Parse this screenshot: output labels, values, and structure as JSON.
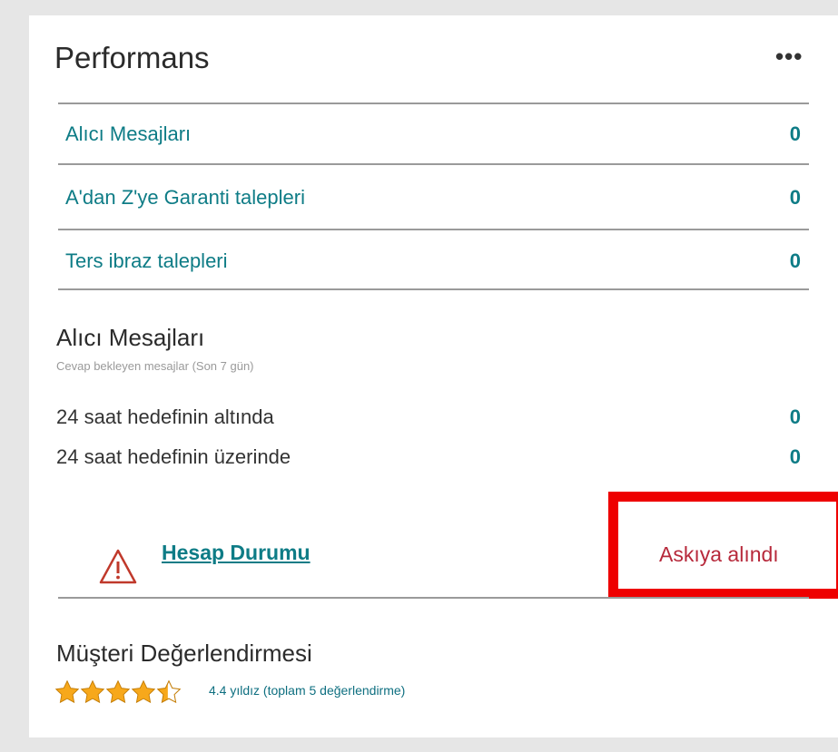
{
  "performance": {
    "title": "Performans",
    "more_label": "•••",
    "rows": [
      {
        "label": "Alıcı Mesajları",
        "value": "0"
      },
      {
        "label": "A'dan Z'ye Garanti talepleri",
        "value": "0"
      },
      {
        "label": "Ters ibraz talepleri",
        "value": "0"
      }
    ]
  },
  "buyer_messages": {
    "title": "Alıcı Mesajları",
    "note": "Cevap bekleyen mesajlar (Son 7 gün)",
    "rows": [
      {
        "label": "24 saat hedefinin altında",
        "value": "0"
      },
      {
        "label": "24 saat hedefinin üzerinde",
        "value": "0"
      }
    ]
  },
  "account_status": {
    "link_label": "Hesap Durumu",
    "status": "Askıya alındı",
    "status_color": "#b7293b",
    "icon": "warning-triangle-icon"
  },
  "customer_rating": {
    "title": "Müşteri Değerlendirmesi",
    "stars": 4.4,
    "max_stars": 5,
    "text": "4.4 yıldız (toplam 5 değerlendirme)"
  },
  "colors": {
    "accent": "#0e7c86",
    "highlight": "#ee0000",
    "star": "#f7a81b"
  }
}
